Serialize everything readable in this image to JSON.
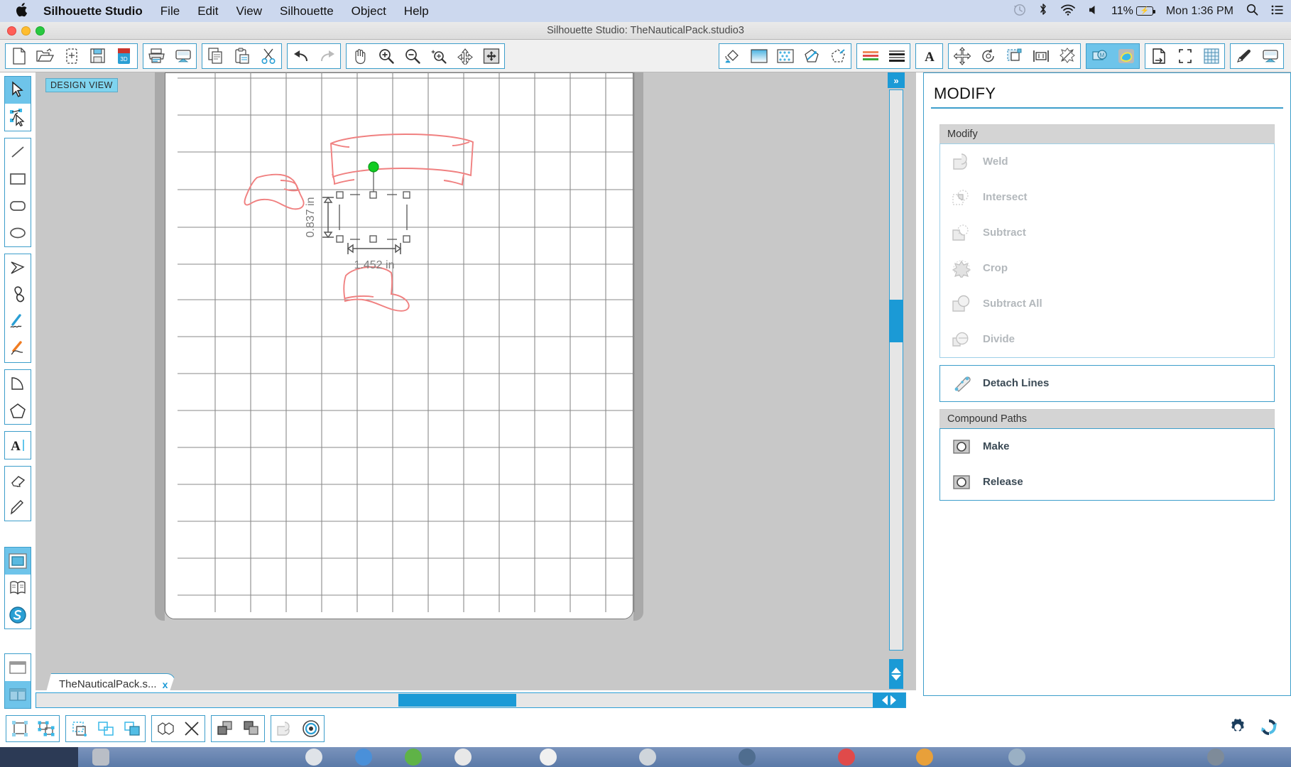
{
  "menubar": {
    "apple_icon": "apple-logo",
    "items": [
      {
        "label": "Silhouette Studio",
        "bold": true
      },
      {
        "label": "File",
        "bold": false
      },
      {
        "label": "Edit",
        "bold": false
      },
      {
        "label": "View",
        "bold": false
      },
      {
        "label": "Silhouette",
        "bold": false
      },
      {
        "label": "Object",
        "bold": false
      },
      {
        "label": "Help",
        "bold": false
      }
    ],
    "status": {
      "time_machine_icon": "time-machine-icon",
      "bluetooth_icon": "bluetooth-icon",
      "wifi_icon": "wifi-icon",
      "volume_icon": "volume-icon",
      "battery_percent": "11%",
      "battery_icon": "battery-charging-icon",
      "clock": "Mon 1:36 PM",
      "search_icon": "spotlight-search-icon",
      "notification_icon": "notification-center-icon"
    }
  },
  "window": {
    "title": "Silhouette Studio: TheNauticalPack.studio3",
    "traffic_lights": [
      "close",
      "minimize",
      "zoom"
    ]
  },
  "toolbar": {
    "groups": [
      {
        "name": "file",
        "buttons": [
          {
            "name": "new-document",
            "icon": "page-icon"
          },
          {
            "name": "open-document",
            "icon": "open-folder-icon"
          },
          {
            "name": "new-from-template",
            "icon": "page-plus-icon"
          },
          {
            "name": "save",
            "icon": "floppy-disk-icon"
          },
          {
            "name": "save-as-studio3",
            "icon": "studio3-file-icon"
          }
        ]
      },
      {
        "name": "output",
        "buttons": [
          {
            "name": "print",
            "icon": "printer-icon"
          },
          {
            "name": "send-to-silhouette",
            "icon": "cut-send-icon"
          }
        ]
      },
      {
        "name": "clipboard",
        "buttons": [
          {
            "name": "copy",
            "icon": "copy-icon"
          },
          {
            "name": "paste",
            "icon": "paste-icon"
          },
          {
            "name": "cut",
            "icon": "scissors-icon"
          }
        ]
      },
      {
        "name": "history",
        "buttons": [
          {
            "name": "undo",
            "icon": "undo-arrow-icon"
          },
          {
            "name": "redo",
            "icon": "redo-arrow-icon"
          }
        ]
      },
      {
        "name": "view",
        "buttons": [
          {
            "name": "pan-tool",
            "icon": "hand-icon"
          },
          {
            "name": "zoom-in",
            "icon": "magnifier-plus-icon"
          },
          {
            "name": "zoom-out",
            "icon": "magnifier-minus-icon"
          },
          {
            "name": "zoom-selection",
            "icon": "magnifier-selection-icon"
          },
          {
            "name": "fit-to-window",
            "icon": "fit-page-icon"
          },
          {
            "name": "fit-to-selection",
            "icon": "fit-selection-icon"
          }
        ]
      },
      {
        "name": "panels-style",
        "buttons": [
          {
            "name": "fill-color-panel",
            "icon": "paint-bucket-icon"
          },
          {
            "name": "gradient-fill-panel",
            "icon": "gradient-icon"
          },
          {
            "name": "pattern-fill-panel",
            "icon": "pattern-icon"
          },
          {
            "name": "line-color-panel",
            "icon": "line-color-icon"
          },
          {
            "name": "line-style-panel",
            "icon": "line-style-icon"
          }
        ]
      },
      {
        "name": "panels-lines",
        "buttons": [
          {
            "name": "sketch-panel",
            "icon": "colored-lines-icon"
          },
          {
            "name": "trace-panel",
            "icon": "stacked-lines-icon"
          }
        ]
      },
      {
        "name": "panels-text",
        "buttons": [
          {
            "name": "text-style-panel",
            "icon": "letter-a-icon"
          }
        ]
      },
      {
        "name": "panels-transform",
        "buttons": [
          {
            "name": "move-panel",
            "icon": "move-arrows-icon"
          },
          {
            "name": "rotate-panel",
            "icon": "rotate-icon"
          },
          {
            "name": "scale-panel",
            "icon": "scale-icon"
          },
          {
            "name": "align-panel",
            "icon": "align-icon"
          },
          {
            "name": "modify-panel",
            "icon": "modify-icon"
          }
        ]
      },
      {
        "name": "panels-offset",
        "buttons": [
          {
            "name": "offset-panel",
            "icon": "offset-icon",
            "selected": true
          },
          {
            "name": "trace-image-panel",
            "icon": "trace-image-icon",
            "selected": true
          }
        ]
      },
      {
        "name": "panels-page",
        "buttons": [
          {
            "name": "page-setup-panel",
            "icon": "page-setup-icon"
          },
          {
            "name": "registration-marks-panel",
            "icon": "registration-marks-icon"
          },
          {
            "name": "grid-panel",
            "icon": "grid-icon"
          }
        ]
      },
      {
        "name": "panels-send",
        "buttons": [
          {
            "name": "pen-holder-panel",
            "icon": "pen-icon"
          },
          {
            "name": "send-panel",
            "icon": "send-cut-icon"
          }
        ]
      }
    ]
  },
  "left_tools": {
    "groups": [
      {
        "name": "selection",
        "buttons": [
          {
            "name": "select-tool",
            "icon": "arrow-cursor-icon",
            "selected": true
          },
          {
            "name": "edit-points-tool",
            "icon": "edit-points-icon"
          }
        ]
      },
      {
        "name": "shapes",
        "buttons": [
          {
            "name": "line-tool",
            "icon": "line-icon"
          },
          {
            "name": "rectangle-tool",
            "icon": "rectangle-icon"
          },
          {
            "name": "rounded-rectangle-tool",
            "icon": "rounded-rectangle-icon"
          },
          {
            "name": "ellipse-tool",
            "icon": "ellipse-icon"
          }
        ]
      },
      {
        "name": "draw",
        "buttons": [
          {
            "name": "polygon-tool",
            "icon": "polyline-icon"
          },
          {
            "name": "curve-tool",
            "icon": "bezier-curve-icon"
          },
          {
            "name": "freehand-tool",
            "icon": "freehand-blue-icon"
          },
          {
            "name": "smooth-freehand-tool",
            "icon": "freehand-orange-icon"
          }
        ]
      },
      {
        "name": "arc",
        "buttons": [
          {
            "name": "arc-tool",
            "icon": "arc-icon"
          },
          {
            "name": "regular-polygon-tool",
            "icon": "pentagon-icon"
          }
        ]
      },
      {
        "name": "text",
        "buttons": [
          {
            "name": "text-tool",
            "icon": "text-a-icon"
          }
        ]
      },
      {
        "name": "erase",
        "buttons": [
          {
            "name": "eraser-tool",
            "icon": "eraser-icon"
          },
          {
            "name": "knife-tool",
            "icon": "knife-icon"
          }
        ]
      },
      {
        "name": "workspace",
        "buttons": [
          {
            "name": "design-page-view",
            "icon": "design-window-icon",
            "selected": true
          },
          {
            "name": "library-view",
            "icon": "library-book-icon"
          },
          {
            "name": "store-view",
            "icon": "silhouette-store-icon"
          }
        ]
      },
      {
        "name": "layout",
        "buttons": [
          {
            "name": "single-pane-layout",
            "icon": "single-pane-icon"
          },
          {
            "name": "split-pane-layout",
            "icon": "split-pane-icon",
            "selected": true
          }
        ]
      }
    ]
  },
  "canvas": {
    "view_badge": "DESIGN VIEW",
    "selection": {
      "height_label": "0.837 in",
      "width_label": "1.452 in",
      "rotate_handle": "rotation-handle",
      "handle_color": "#00cc22"
    },
    "artwork_stroke": "#f08080",
    "grid_color": "#8a8a8a"
  },
  "tab": {
    "label": "TheNauticalPack.s...",
    "close": "x"
  },
  "right_panel": {
    "title": "MODIFY",
    "sections": [
      {
        "header": "Modify",
        "items": [
          {
            "label": "Weld",
            "icon": "weld-icon",
            "disabled": true
          },
          {
            "label": "Intersect",
            "icon": "intersect-icon",
            "disabled": true
          },
          {
            "label": "Subtract",
            "icon": "subtract-icon",
            "disabled": true
          },
          {
            "label": "Crop",
            "icon": "crop-icon",
            "disabled": true
          },
          {
            "label": "Subtract All",
            "icon": "subtract-all-icon",
            "disabled": true
          },
          {
            "label": "Divide",
            "icon": "divide-icon",
            "disabled": true
          }
        ]
      },
      {
        "header": null,
        "items": [
          {
            "label": "Detach Lines",
            "icon": "detach-lines-icon",
            "disabled": false
          }
        ]
      },
      {
        "header": "Compound Paths",
        "items": [
          {
            "label": "Make",
            "icon": "compound-make-icon",
            "disabled": false
          },
          {
            "label": "Release",
            "icon": "compound-release-icon",
            "disabled": false
          }
        ]
      }
    ]
  },
  "bottom_toolbar": {
    "groups": [
      {
        "name": "group-ungroup",
        "buttons": [
          {
            "name": "group",
            "icon": "group-icon"
          },
          {
            "name": "ungroup",
            "icon": "ungroup-icon"
          }
        ]
      },
      {
        "name": "path-ops",
        "buttons": [
          {
            "name": "make-compound-path",
            "icon": "compound-path-icon"
          },
          {
            "name": "duplicate",
            "icon": "duplicate-icon"
          },
          {
            "name": "replicate",
            "icon": "replicate-filled-icon"
          }
        ]
      },
      {
        "name": "weld-tools",
        "buttons": [
          {
            "name": "weld-shapes",
            "icon": "weld-shapes-icon"
          },
          {
            "name": "delete-shape",
            "icon": "x-delete-icon"
          }
        ]
      },
      {
        "name": "arrange",
        "buttons": [
          {
            "name": "bring-to-front",
            "icon": "bring-front-icon"
          },
          {
            "name": "send-to-back",
            "icon": "send-back-icon"
          }
        ]
      },
      {
        "name": "misc",
        "buttons": [
          {
            "name": "merge-shape",
            "icon": "merge-shape-icon"
          },
          {
            "name": "registration-target",
            "icon": "target-icon"
          }
        ]
      }
    ],
    "right_buttons": [
      {
        "name": "preferences",
        "icon": "gear-icon"
      },
      {
        "name": "sync-refresh",
        "icon": "sync-icon"
      }
    ]
  },
  "colors": {
    "accent_blue": "#1b9ad6",
    "panel_border": "#3d9ecb",
    "menubar_bg": "#ccd8ee",
    "canvas_bg": "#c8c8c8",
    "artwork": "#f08080",
    "selection_handle": "#00cc22"
  }
}
